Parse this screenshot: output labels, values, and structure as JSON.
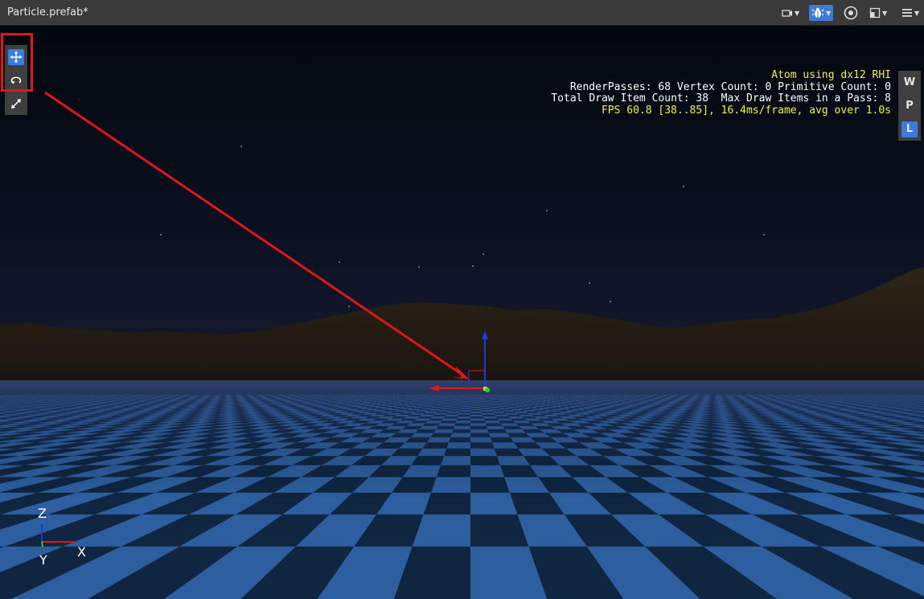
{
  "window": {
    "title": "Particle.prefab*"
  },
  "toolbar_right": [
    "W",
    "P",
    "L"
  ],
  "stats": {
    "line1": "Atom using dx12 RHI",
    "line2": "RenderPasses: 68 Vertex Count: 0 Primitive Count: 0",
    "line3": "Total Draw Item Count: 38  Max Draw Items in a Pass: 8",
    "line4": "FPS 60.8 [38..85], 16.4ms/frame, avg over 1.0s"
  },
  "axis_gizmo": {
    "z": "Z",
    "y": "Y",
    "x": "X"
  },
  "colors": {
    "titlebar": "#3a3a3a",
    "accent_blue": "#3c7be0",
    "stats_yellow": "#f3f03c",
    "annotation_red": "#e0161a",
    "sky_top": "#05080f",
    "floor_light": "#2d5fa0",
    "floor_dark": "#0f2540"
  },
  "icons": {
    "camera": "camera-icon",
    "debug": "bug-icon",
    "visibility": "eye-icon",
    "layout": "layout-icon",
    "menu": "hamburger-icon",
    "move": "move-icon",
    "rotate": "rotate-icon",
    "scale": "scale-icon"
  }
}
